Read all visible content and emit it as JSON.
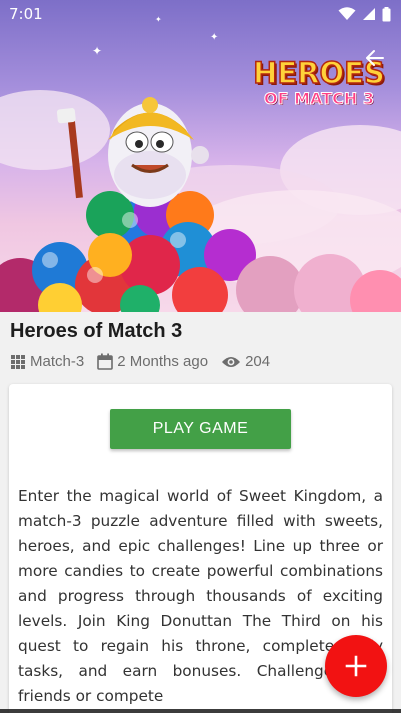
{
  "status_bar": {
    "time": "7:01"
  },
  "hero": {
    "logo_line1": "HEROES",
    "logo_line2": "OF MATCH 3"
  },
  "game": {
    "title": "Heroes of Match 3",
    "category": "Match-3",
    "date": "2 Months ago",
    "views": "204"
  },
  "actions": {
    "play_label": "PLAY GAME"
  },
  "description": "Enter the magical world of Sweet Kingdom, a match-3 puzzle adventure filled with sweets, heroes, and epic challenges! Line up three or more candies to create powerful combinations and progress through thousands of exciting levels. Join King Donuttan The Third on his quest to regain his throne, complete daily tasks, and earn bonuses. Challenge your friends or compete",
  "colors": {
    "accent": "#43a047",
    "fab": "#f21212"
  },
  "icons": [
    "wifi-icon",
    "signal-icon",
    "battery-icon",
    "back-arrow-icon",
    "grid-icon",
    "calendar-icon",
    "eye-icon",
    "plus-icon"
  ]
}
